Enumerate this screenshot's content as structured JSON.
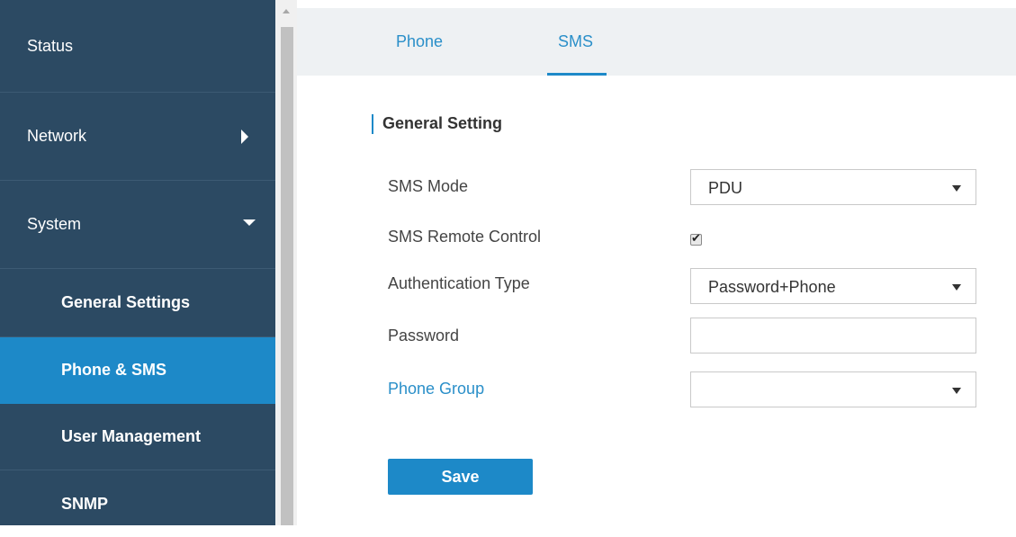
{
  "sidebar": {
    "items": [
      {
        "label": "Status"
      },
      {
        "label": "Network"
      },
      {
        "label": "System"
      },
      {
        "label": "General Settings"
      },
      {
        "label": "Phone & SMS"
      },
      {
        "label": "User Management"
      },
      {
        "label": "SNMP"
      }
    ],
    "active_color": "#1d89c8",
    "background_color": "#2c4a63"
  },
  "tabs": [
    {
      "label": "Phone"
    },
    {
      "label": "SMS"
    }
  ],
  "section": {
    "title": "General Setting"
  },
  "form": {
    "sms_mode": {
      "label": "SMS Mode",
      "value": "PDU"
    },
    "remote_control": {
      "label": "SMS Remote Control",
      "checked": true
    },
    "auth_type": {
      "label": "Authentication Type",
      "value": "Password+Phone"
    },
    "password": {
      "label": "Password",
      "value": ""
    },
    "phone_group": {
      "label": "Phone Group",
      "value": ""
    }
  },
  "save_label": "Save"
}
